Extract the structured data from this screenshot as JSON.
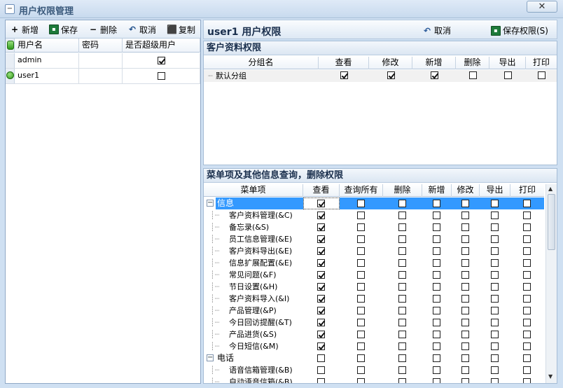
{
  "window": {
    "title": "用户权限管理",
    "close_glyph": "✕"
  },
  "toolbar": {
    "add_label": "新增",
    "save_label": "保存",
    "delete_label": "删除",
    "cancel_label": "取消",
    "copy_label": "复制"
  },
  "users_table": {
    "columns": [
      "用户名",
      "密码",
      "是否超级用户"
    ],
    "rows": [
      {
        "username": "admin",
        "password": "",
        "is_super": true
      },
      {
        "username": "user1",
        "password": "",
        "is_super": false
      }
    ]
  },
  "right_header": {
    "title": "user1 用户权限",
    "cancel_label": "取消",
    "save_label": "保存权限(S)"
  },
  "customer_section": {
    "title": "客户资料权限",
    "columns": [
      "分组名",
      "查看",
      "修改",
      "新增",
      "删除",
      "导出",
      "打印"
    ],
    "rows": [
      {
        "name": "默认分组",
        "checks": [
          true,
          true,
          true,
          false,
          false,
          false
        ]
      }
    ]
  },
  "menu_section": {
    "title": "菜单项及其他信息查询，删除权限",
    "columns": [
      "菜单项",
      "查看",
      "查询所有",
      "删除",
      "新增",
      "修改",
      "导出",
      "打印"
    ],
    "rows": [
      {
        "name": "信息",
        "level": 0,
        "expander": "−",
        "highlight": true,
        "checks": [
          true,
          false,
          false,
          false,
          false,
          false,
          false
        ]
      },
      {
        "name": "客户资料管理(&C)",
        "level": 1,
        "checks": [
          true,
          false,
          false,
          false,
          false,
          false,
          false
        ]
      },
      {
        "name": "备忘录(&S)",
        "level": 1,
        "checks": [
          true,
          false,
          false,
          false,
          false,
          false,
          false
        ]
      },
      {
        "name": "员工信息管理(&E)",
        "level": 1,
        "checks": [
          true,
          false,
          false,
          false,
          false,
          false,
          false
        ]
      },
      {
        "name": "客户资料导出(&E)",
        "level": 1,
        "checks": [
          true,
          false,
          false,
          false,
          false,
          false,
          false
        ]
      },
      {
        "name": "信息扩展配置(&E)",
        "level": 1,
        "checks": [
          true,
          false,
          false,
          false,
          false,
          false,
          false
        ]
      },
      {
        "name": "常见问题(&F)",
        "level": 1,
        "checks": [
          true,
          false,
          false,
          false,
          false,
          false,
          false
        ]
      },
      {
        "name": "节日设置(&H)",
        "level": 1,
        "checks": [
          true,
          false,
          false,
          false,
          false,
          false,
          false
        ]
      },
      {
        "name": "客户资料导入(&I)",
        "level": 1,
        "checks": [
          true,
          false,
          false,
          false,
          false,
          false,
          false
        ]
      },
      {
        "name": "产品管理(&P)",
        "level": 1,
        "checks": [
          true,
          false,
          false,
          false,
          false,
          false,
          false
        ]
      },
      {
        "name": "今日回访提醒(&T)",
        "level": 1,
        "checks": [
          true,
          false,
          false,
          false,
          false,
          false,
          false
        ]
      },
      {
        "name": "产品进货(&S)",
        "level": 1,
        "checks": [
          true,
          false,
          false,
          false,
          false,
          false,
          false
        ]
      },
      {
        "name": "今日短信(&M)",
        "level": 1,
        "checks": [
          true,
          false,
          false,
          false,
          false,
          false,
          false
        ]
      },
      {
        "name": "电话",
        "level": 0,
        "expander": "−",
        "highlight": false,
        "checks": [
          false,
          false,
          false,
          false,
          false,
          false,
          false
        ]
      },
      {
        "name": "语音信箱管理(&B)",
        "level": 1,
        "checks": [
          false,
          false,
          false,
          false,
          false,
          false,
          false
        ]
      },
      {
        "name": "自动语音信箱(&B)",
        "level": 1,
        "checks": [
          false,
          false,
          false,
          false,
          false,
          false,
          false
        ]
      }
    ]
  },
  "icons": [
    "plus-icon",
    "save-icon",
    "minus-icon",
    "undo-icon",
    "copy-icon",
    "cancel-icon",
    "scroll-up-icon",
    "scroll-down-icon"
  ]
}
